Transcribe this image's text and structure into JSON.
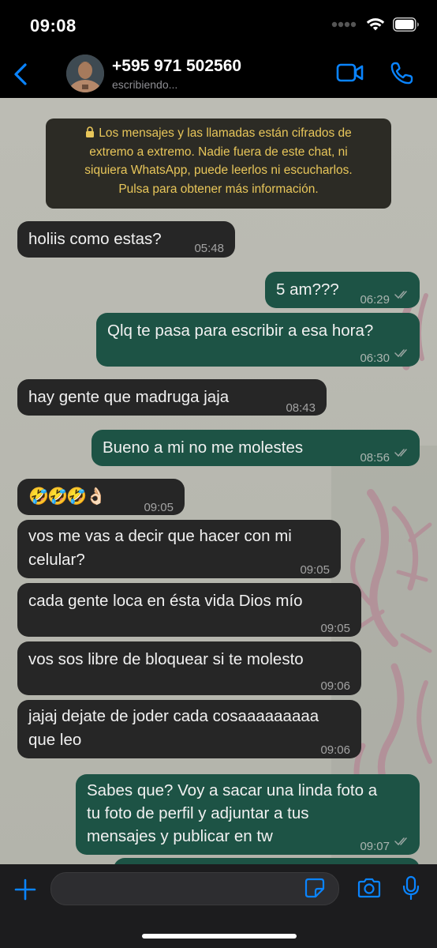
{
  "status_bar": {
    "time": "09:08"
  },
  "header": {
    "contact_name": "+595 971 502560",
    "contact_status": "escribiendo..."
  },
  "encryption_notice": {
    "text_line1": "Los mensajes y las llamadas están cifrados de",
    "text_line2": "extremo a extremo. Nadie fuera de este chat, ni",
    "text_line3": "siquiera WhatsApp, puede leerlos ni escucharlos.",
    "text_line4": "Pulsa para obtener más información."
  },
  "messages": [
    {
      "dir": "in",
      "lines": [
        "holiis como estas?"
      ],
      "time": "05:48"
    },
    {
      "dir": "out",
      "lines": [
        "5 am???"
      ],
      "time": "06:29",
      "status": "read"
    },
    {
      "dir": "out",
      "lines": [
        "Qlq te pasa para escribir a esa hora?"
      ],
      "time": "06:30",
      "status": "read"
    },
    {
      "dir": "in",
      "lines": [
        "hay gente que madruga jaja"
      ],
      "time": "08:43"
    },
    {
      "dir": "out",
      "lines": [
        "Bueno a mi no me molestes"
      ],
      "time": "08:56",
      "status": "read"
    },
    {
      "dir": "in",
      "lines": [
        "🤣🤣🤣👌🏻"
      ],
      "time": "09:05"
    },
    {
      "dir": "in",
      "lines": [
        "vos me vas a decir que hacer con mi",
        "celular?"
      ],
      "time": "09:05"
    },
    {
      "dir": "in",
      "lines": [
        "cada gente loca en ésta  vida Dios mío"
      ],
      "time": "09:05"
    },
    {
      "dir": "in",
      "lines": [
        "vos sos libre de bloquear si te molesto"
      ],
      "time": "09:06"
    },
    {
      "dir": "in",
      "lines": [
        "jajaj dejate de joder cada cosaaaaaaaaa",
        "que leo"
      ],
      "time": "09:06"
    },
    {
      "dir": "out",
      "lines": [
        "Sabes que? Voy a sacar una linda foto a",
        "tu foto de perfil y adjuntar a tus",
        "mensajes y publicar en tw"
      ],
      "time": "09:07",
      "status": "read"
    }
  ],
  "composer": {
    "placeholder": ""
  },
  "colors": {
    "accent": "#0a84ff",
    "incoming_bubble": "#262626",
    "outgoing_bubble": "#1d5345",
    "encryption_text": "#e8c65a",
    "read_ticks": "#9aa6a2"
  },
  "icons": [
    "back-chevron-icon",
    "video-call-icon",
    "phone-icon",
    "lock-icon",
    "plus-icon",
    "sticker-icon",
    "camera-icon",
    "microphone-icon",
    "wifi-icon",
    "battery-icon",
    "signal-icon"
  ]
}
